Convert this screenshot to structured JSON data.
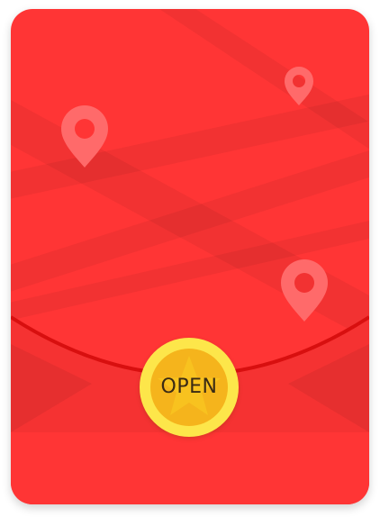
{
  "envelope": {
    "open_button": {
      "label": "OPEN"
    },
    "icons": [
      "map-pin-icon",
      "map-pin-icon",
      "map-pin-icon",
      "star-icon"
    ]
  },
  "colors": {
    "envelope_red": "#ff3535",
    "flap_line": "#d80f0f",
    "coin_outer": "#fde64a",
    "coin_inner": "#f5b41c",
    "label": "#3a2a14"
  }
}
